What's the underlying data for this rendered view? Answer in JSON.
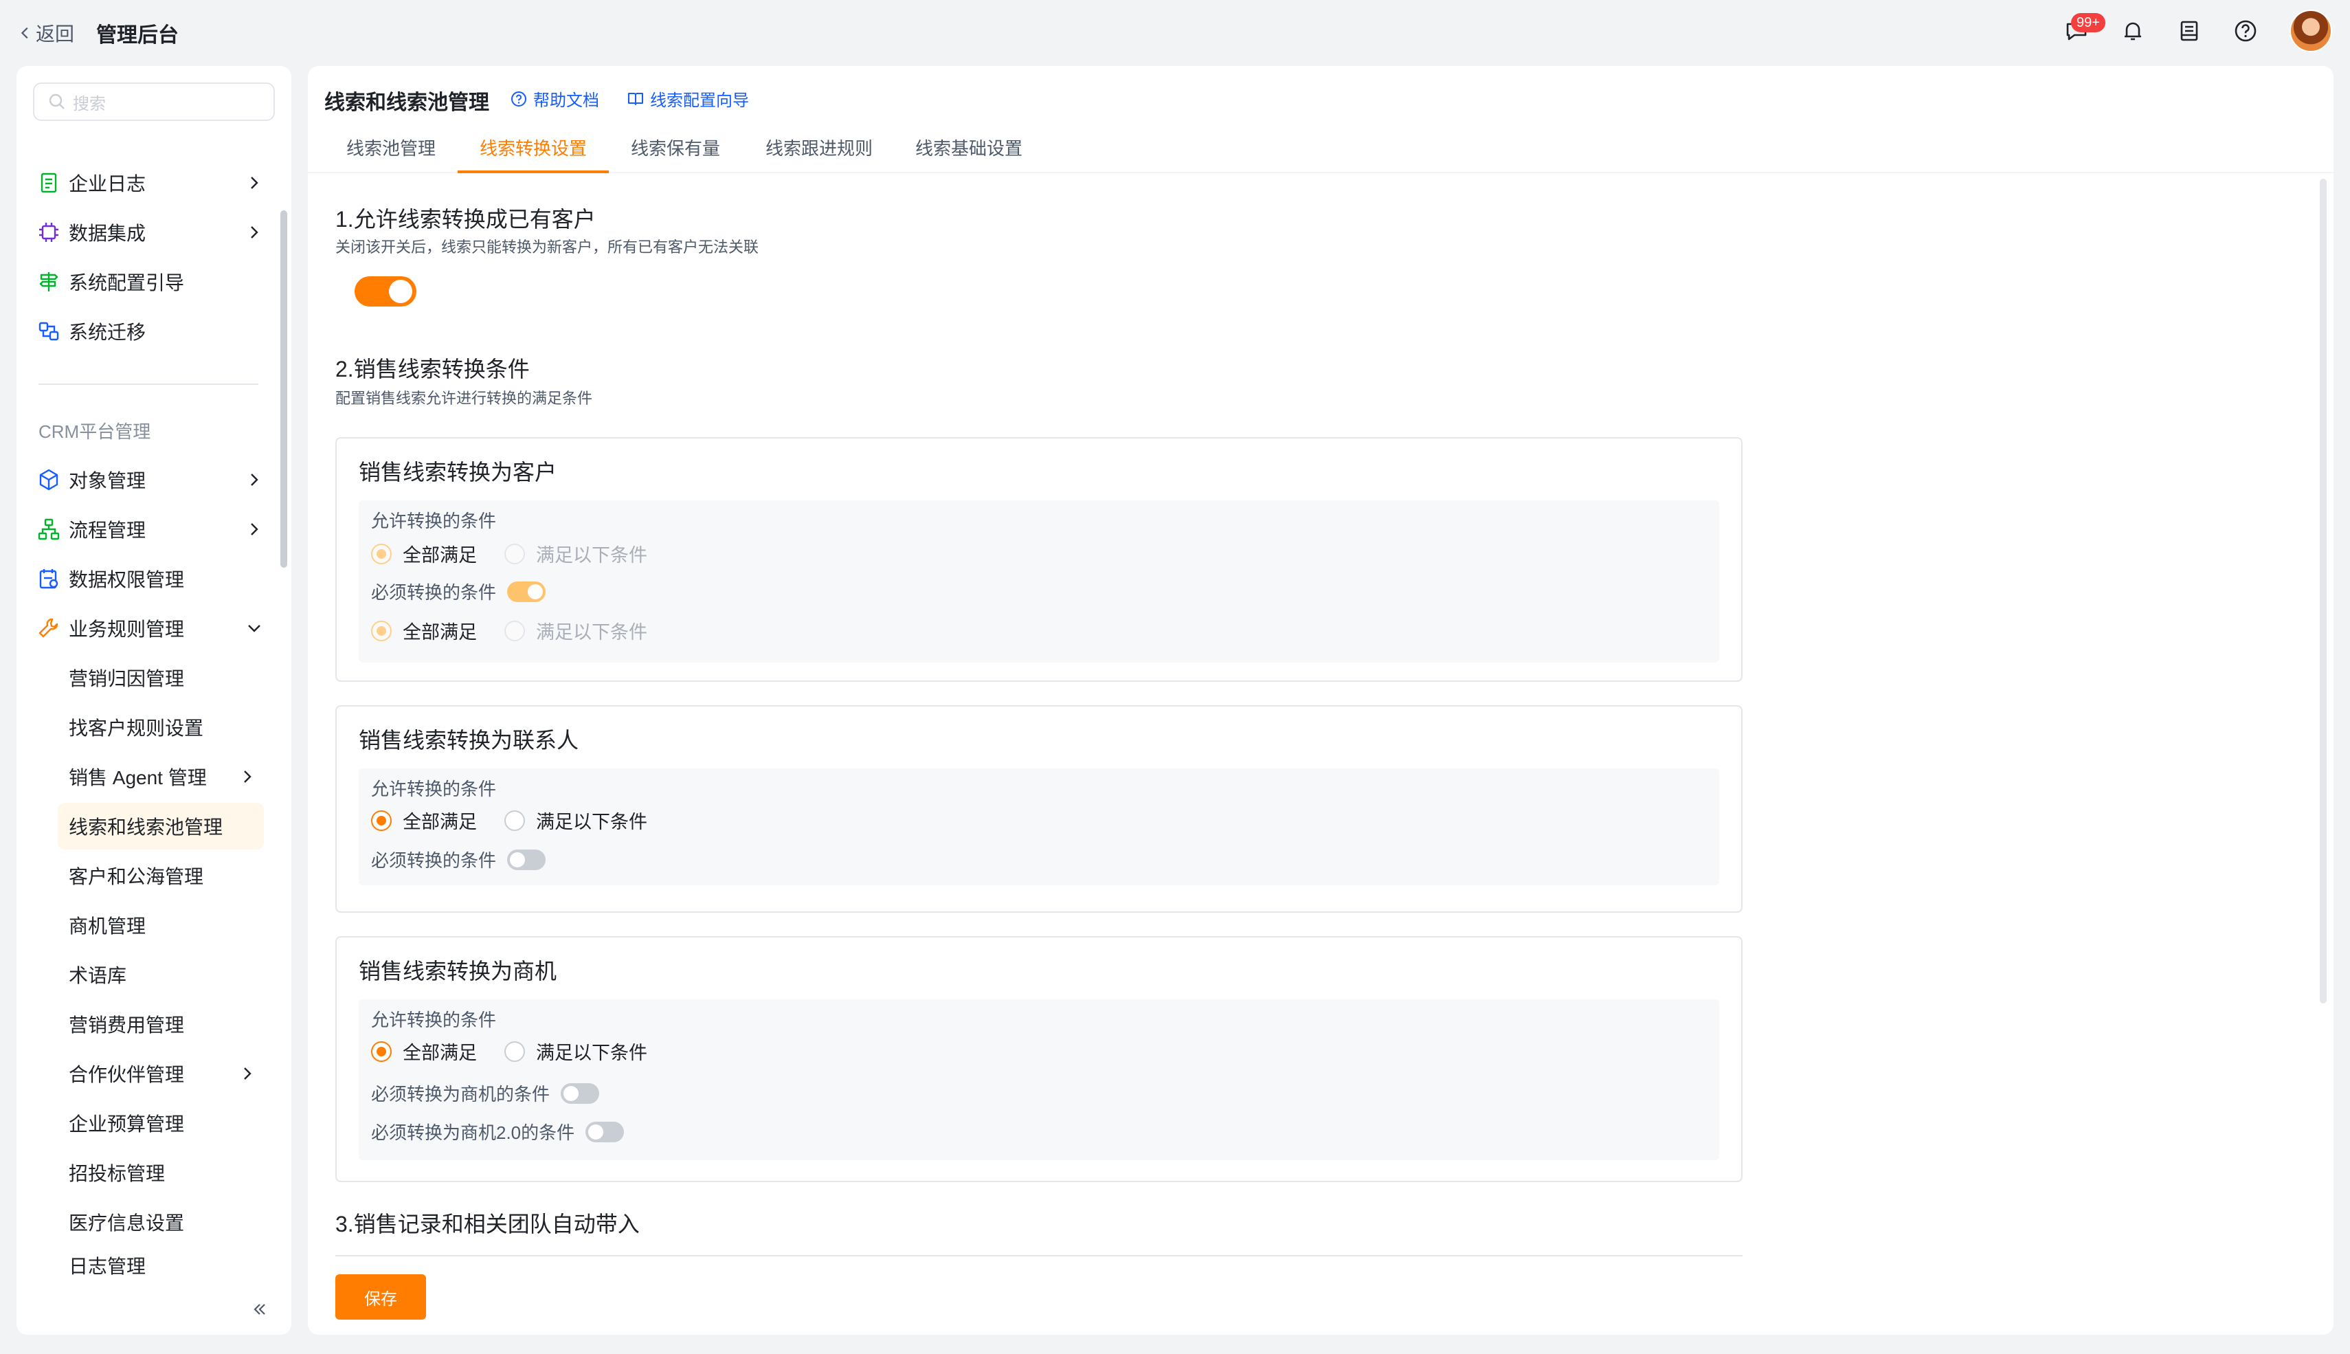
{
  "header": {
    "back_label": "返回",
    "app_title": "管理后台",
    "notification_count": "99+"
  },
  "sidebar": {
    "search_placeholder": "搜索",
    "items_top": [
      {
        "label": "企业日志",
        "icon": "document-icon",
        "has_chevron": true
      },
      {
        "label": "数据集成",
        "icon": "chip-icon",
        "has_chevron": true
      },
      {
        "label": "系统配置引导",
        "icon": "signpost-icon",
        "has_chevron": false
      },
      {
        "label": "系统迁移",
        "icon": "migrate-icon",
        "has_chevron": false
      }
    ],
    "section_label": "CRM平台管理",
    "items_crm": [
      {
        "label": "对象管理",
        "icon": "cube-icon",
        "has_chevron": true
      },
      {
        "label": "流程管理",
        "icon": "flow-icon",
        "has_chevron": true
      },
      {
        "label": "数据权限管理",
        "icon": "data-permission-icon",
        "has_chevron": false
      },
      {
        "label": "业务规则管理",
        "icon": "wrench-icon",
        "has_chevron": true,
        "expanded": true
      }
    ],
    "sub_items": [
      {
        "label": "营销归因管理"
      },
      {
        "label": "找客户规则设置"
      },
      {
        "label": "销售 Agent 管理",
        "has_chevron": true
      },
      {
        "label": "线索和线索池管理",
        "active": true
      },
      {
        "label": "客户和公海管理"
      },
      {
        "label": "商机管理"
      },
      {
        "label": "术语库"
      },
      {
        "label": "营销费用管理"
      },
      {
        "label": "合作伙伴管理",
        "has_chevron": true
      },
      {
        "label": "企业预算管理"
      },
      {
        "label": "招投标管理"
      },
      {
        "label": "医疗信息设置"
      },
      {
        "label": "日志管理"
      }
    ]
  },
  "main": {
    "title": "线索和线索池管理",
    "help_link": "帮助文档",
    "guide_link": "线索配置向导",
    "tabs": [
      {
        "label": "线索池管理"
      },
      {
        "label": "线索转换设置",
        "active": true
      },
      {
        "label": "线索保有量"
      },
      {
        "label": "线索跟进规则"
      },
      {
        "label": "线索基础设置"
      }
    ],
    "section1": {
      "title": "1.允许线索转换成已有客户",
      "desc": "关闭该开关后，线索只能转换为新客户，所有已有客户无法关联",
      "toggle_on": true
    },
    "section2": {
      "title": "2.销售线索转换条件",
      "desc": "配置销售线索允许进行转换的满足条件"
    },
    "cards": [
      {
        "title": "销售线索转换为客户",
        "allow_label": "允许转换的条件",
        "opt_all": "全部满足",
        "opt_some": "满足以下条件",
        "must_label": "必须转换的条件",
        "must_toggle_on": true
      },
      {
        "title": "销售线索转换为联系人",
        "allow_label": "允许转换的条件",
        "opt_all": "全部满足",
        "opt_some": "满足以下条件",
        "must_label": "必须转换的条件",
        "must_toggle_on": false
      },
      {
        "title": "销售线索转换为商机",
        "allow_label": "允许转换的条件",
        "opt_all": "全部满足",
        "opt_some": "满足以下条件",
        "must_label_1": "必须转换为商机的条件",
        "must_label_2": "必须转换为商机2.0的条件"
      }
    ],
    "section3": {
      "title": "3.销售记录和相关团队自动带入"
    },
    "save_label": "保存"
  },
  "colors": {
    "accent": "#ff7d00",
    "link": "#165dff",
    "badge": "#f53f3f"
  }
}
